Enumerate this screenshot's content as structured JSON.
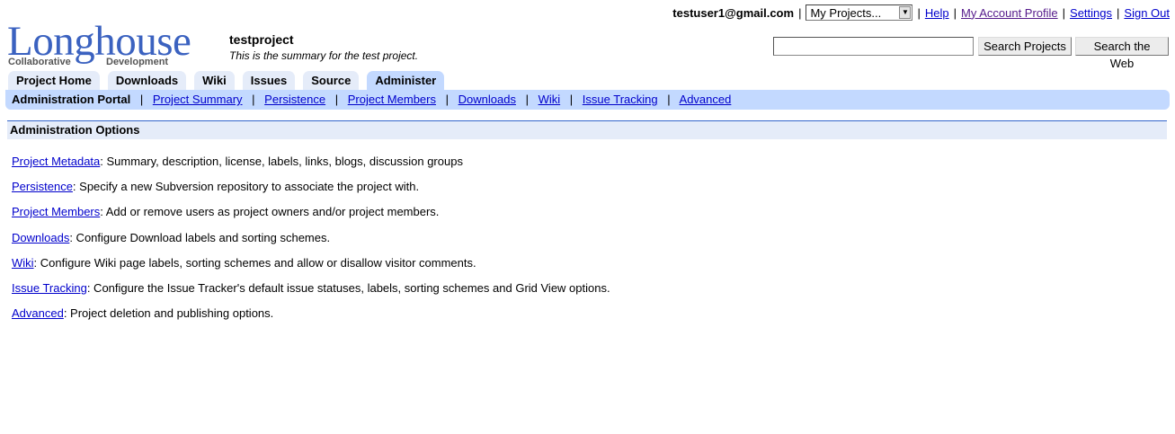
{
  "userbar": {
    "email": "testuser1@gmail.com",
    "sep": "|",
    "projects_select": "My Projects...",
    "links": [
      "Help",
      "My Account Profile",
      "Settings",
      "Sign Out"
    ]
  },
  "logo": {
    "word": "Longhouse",
    "tag_left": "Collaborative",
    "tag_right": "Development"
  },
  "project": {
    "name": "testproject",
    "summary": "This is the summary for the test project."
  },
  "search": {
    "value": "",
    "btn_projects": "Search Projects",
    "btn_web": "Search the Web"
  },
  "tabs": [
    "Project Home",
    "Downloads",
    "Wiki",
    "Issues",
    "Source",
    "Administer"
  ],
  "subnav": {
    "current": "Administration Portal",
    "sep": "|",
    "links": [
      "Project Summary",
      "Persistence",
      "Project Members",
      "Downloads",
      "Wiki",
      "Issue Tracking",
      "Advanced"
    ]
  },
  "admin": {
    "title": "Administration Options",
    "options": [
      {
        "link": "Project Metadata",
        "desc": ": Summary, description, license, labels, links, blogs, discussion groups"
      },
      {
        "link": "Persistence",
        "desc": ": Specify a new Subversion repository to associate the project with."
      },
      {
        "link": "Project Members",
        "desc": ": Add or remove users as project owners and/or project members."
      },
      {
        "link": "Downloads",
        "desc": ": Configure Download labels and sorting schemes."
      },
      {
        "link": "Wiki",
        "desc": ": Configure Wiki page labels, sorting schemes and allow or disallow visitor comments."
      },
      {
        "link": "Issue Tracking",
        "desc": ": Configure the Issue Tracker's default issue statuses, labels, sorting schemes and Grid View options."
      },
      {
        "link": "Advanced",
        "desc": ": Project deletion and publishing options."
      }
    ]
  }
}
